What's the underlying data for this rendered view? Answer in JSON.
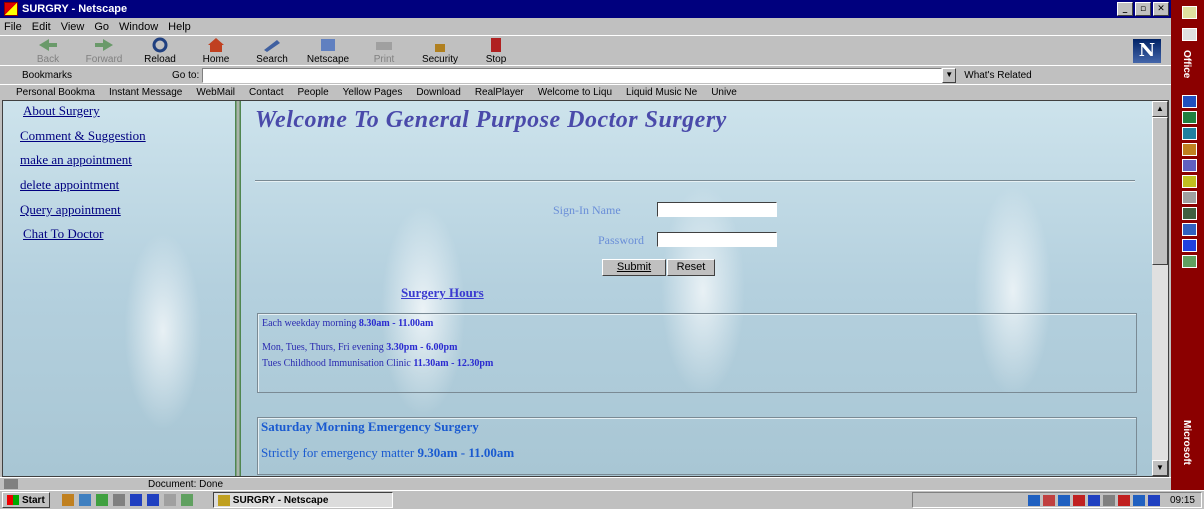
{
  "window": {
    "title": "SURGRY - Netscape",
    "min": "_",
    "max": "▫",
    "close": "✕"
  },
  "menu": [
    "File",
    "Edit",
    "View",
    "Go",
    "Window",
    "Help"
  ],
  "toolbar": {
    "back": "Back",
    "forward": "Forward",
    "reload": "Reload",
    "home": "Home",
    "search": "Search",
    "netscape": "Netscape",
    "print": "Print",
    "security": "Security",
    "stop": "Stop",
    "logo": "N"
  },
  "location": {
    "bookmarks": "Bookmarks",
    "goto": "Go to:",
    "url": "",
    "related": "What's Related"
  },
  "personal": [
    "Personal Bookma",
    "Instant Message",
    "WebMail",
    "Contact",
    "People",
    "Yellow Pages",
    "Download",
    "RealPlayer",
    "Welcome to Liqu",
    "Liquid Music Ne",
    "Unive"
  ],
  "nav": [
    "About Surgery",
    "Comment & Suggestion",
    "make an appointment",
    "delete appointment",
    "Query appointment",
    "Chat To Doctor"
  ],
  "main": {
    "welcome": "Welcome To General Purpose Doctor Surgery",
    "signin_label": "Sign-In Name",
    "password_label": "Password",
    "signin_value": "",
    "password_value": "",
    "submit": "Submit",
    "reset": "Reset",
    "hours_link": "Surgery Hours",
    "hours": [
      {
        "text": "Each weekday morning",
        "time": "8.30am - 11.00am"
      },
      {
        "text": "Mon, Tues, Thurs, Fri evening",
        "time": "3.30pm - 6.00pm"
      },
      {
        "text": "Tues Childhood Immunisation Clinic",
        "time": "11.30am - 12.30pm"
      }
    ],
    "saturday_title": "Saturday Morning Emergency Surgery",
    "saturday_text": "Strictly for emergency matter",
    "saturday_time": "9.30am - 11.00am"
  },
  "status": {
    "text": "Document: Done"
  },
  "taskbar": {
    "start": "Start",
    "task": "SURGRY - Netscape",
    "clock": "09:15"
  },
  "office": {
    "top": "Office",
    "bottom": "Microsoft"
  }
}
